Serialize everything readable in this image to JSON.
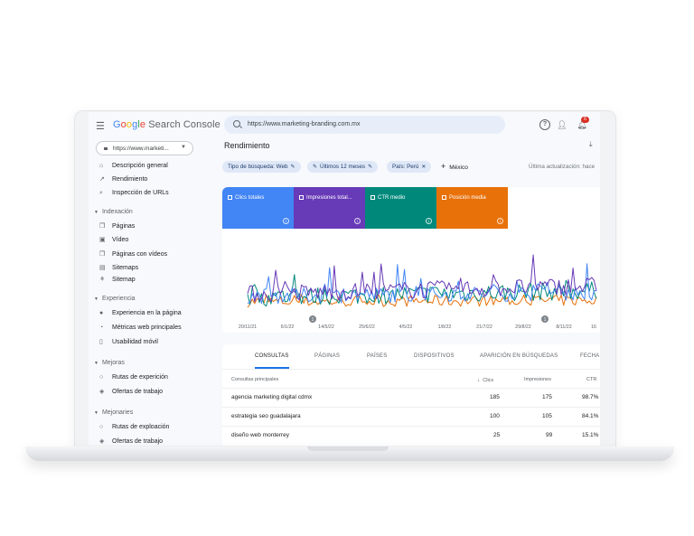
{
  "app": {
    "brand_parts": [
      "G",
      "o",
      "o",
      "g",
      "l",
      "e"
    ],
    "brand_suffix": "Search Console",
    "search_url": "https://www.marketing-branding.com.mx",
    "notification_count": "6"
  },
  "sidebar": {
    "property": "https://www.marketi...",
    "items_top": [
      {
        "icon": "home-icon",
        "label": "Descripción general"
      },
      {
        "icon": "trending-icon",
        "label": "Rendimiento"
      },
      {
        "icon": "search-icon",
        "label": "Inspección de URLs"
      }
    ],
    "sections": [
      {
        "title": "Indexación",
        "items": [
          {
            "icon": "pages-icon",
            "label": "Páginas"
          },
          {
            "icon": "video-icon",
            "label": "Vídeo"
          },
          {
            "icon": "video-pages-icon",
            "label": "Páginas con vídeos"
          },
          {
            "icon": "sitemaps-icon",
            "label": "Sitemaps"
          },
          {
            "icon": "sitemap-icon",
            "label": "Sitemap"
          }
        ]
      },
      {
        "title": "Experiencia",
        "items": [
          {
            "icon": "page-experience-icon",
            "label": "Experiencia en la página"
          },
          {
            "icon": "web-vitals-icon",
            "label": "Métricas web principales"
          },
          {
            "icon": "mobile-icon",
            "label": "Usabilidad móvil"
          }
        ]
      },
      {
        "title": "Mejoras",
        "items": [
          {
            "icon": "routes-icon",
            "label": "Rutas de experición"
          },
          {
            "icon": "jobs-icon",
            "label": "Ofertas de trabajo"
          }
        ]
      },
      {
        "title": "Mejonaries",
        "items": [
          {
            "icon": "routes-icon",
            "label": "Rutas de exploación"
          },
          {
            "icon": "jobs-icon",
            "label": "Ofertas de trabajo"
          }
        ]
      }
    ]
  },
  "main": {
    "title": "Rendimiento",
    "filters": {
      "search_type": "Tipo de búsqueda: Web",
      "date": "Últimos 12 meses",
      "country": "País: Perú",
      "add": "México"
    },
    "last_update": "Última actualización: hace",
    "metrics": [
      {
        "label": "Clics totales",
        "color": "#4285f4"
      },
      {
        "label": "Impresiones total...",
        "color": "#673ab7"
      },
      {
        "label": "CTR medio",
        "color": "#00897b"
      },
      {
        "label": "Posición media",
        "color": "#e8710a"
      }
    ],
    "info_glyph": "i",
    "annotation_glyph": "1"
  },
  "chart_data": {
    "type": "line",
    "x": [
      "20/11/21",
      "6/1/22",
      "14/5/22",
      "25/6/22",
      "4/5/22",
      "1/8/22",
      "21/7/22",
      "29/8/22",
      "8/11/22",
      "16"
    ],
    "series": [],
    "annotations": [
      "1",
      "1"
    ],
    "grid": false,
    "legend": "none"
  },
  "table": {
    "tabs": [
      "CONSULTAS",
      "PÁGINAS",
      "PAÍSES",
      "DISPOSITIVOS",
      "APARICIÓN EN BÚSQUEDAS",
      "FECHA"
    ],
    "headers": {
      "query": "Consultas principales",
      "clicks": "Clics",
      "impressions": "Impresiones",
      "ctr": "CTR"
    },
    "rows": [
      {
        "query": "agencia marketing digital cdmx",
        "clicks": "185",
        "impressions": "175",
        "ctr": "98.7%"
      },
      {
        "query": "estrategia seo guadalajara",
        "clicks": "100",
        "impressions": "105",
        "ctr": "84.1%"
      },
      {
        "query": "diseño web monterrey",
        "clicks": "25",
        "impressions": "99",
        "ctr": "15.1%"
      }
    ]
  }
}
